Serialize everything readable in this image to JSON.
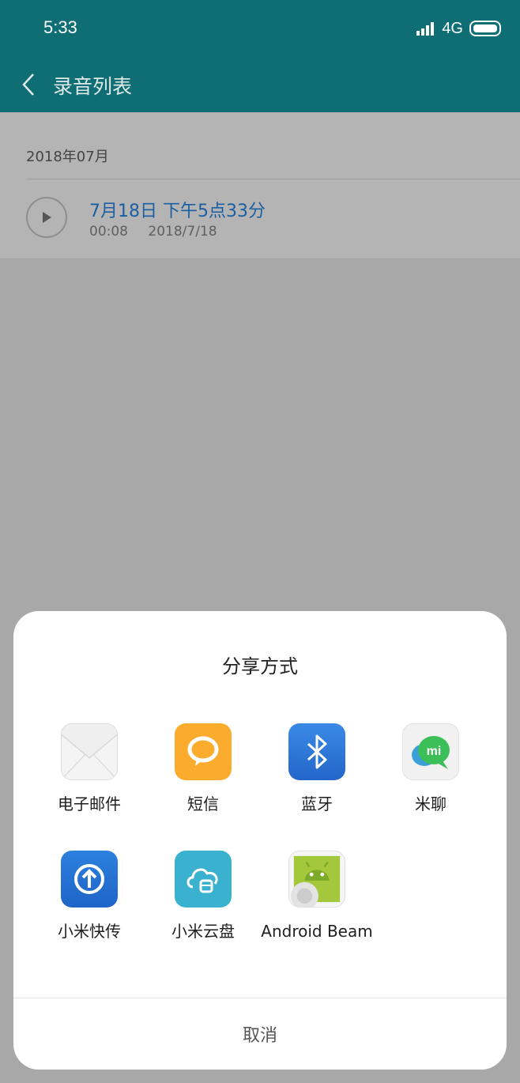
{
  "status_bar": {
    "time": "5:33",
    "network": "4G"
  },
  "app_bar": {
    "back_icon": "chevron-left-icon",
    "title": "录音列表"
  },
  "recordings": {
    "section_header": "2018年07月",
    "items": [
      {
        "title": "7月18日 下午5点33分",
        "duration": "00:08",
        "date": "2018/7/18"
      }
    ]
  },
  "share_sheet": {
    "title": "分享方式",
    "options": [
      {
        "label": "电子邮件",
        "icon": "envelope-icon"
      },
      {
        "label": "短信",
        "icon": "message-bubble-icon"
      },
      {
        "label": "蓝牙",
        "icon": "bluetooth-icon"
      },
      {
        "label": "米聊",
        "icon": "mi-chat-icon"
      },
      {
        "label": "小米快传",
        "icon": "upload-arrow-icon"
      },
      {
        "label": "小米云盘",
        "icon": "cloud-drive-icon"
      },
      {
        "label": "Android Beam",
        "icon": "android-icon"
      }
    ],
    "cancel_label": "取消"
  },
  "colors": {
    "header_bg": "#0f6e74",
    "accent_blue": "#1b5fa3",
    "sms_orange": "#fbac2d",
    "bluetooth_blue": "#2c7ce0",
    "mi_green": "#3cbf59",
    "cloud_teal": "#3ab2cf"
  }
}
